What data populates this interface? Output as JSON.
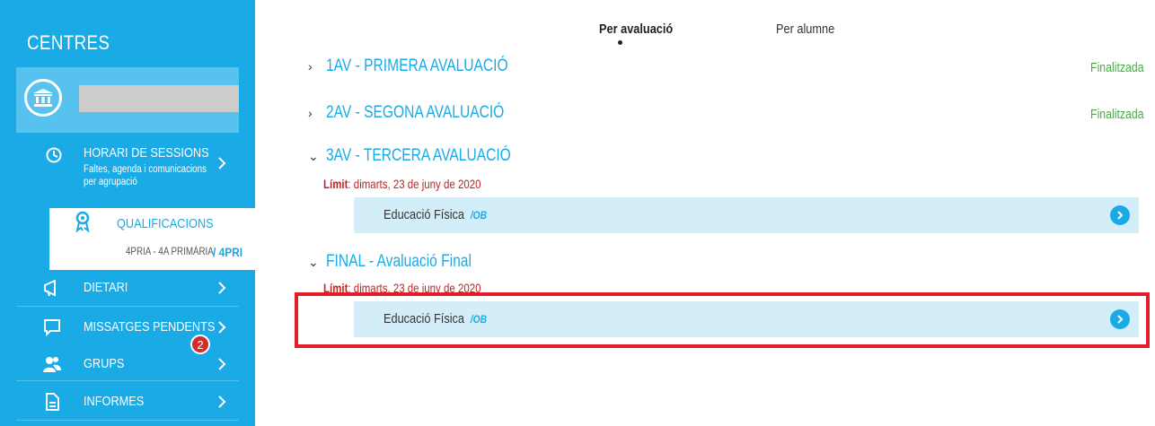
{
  "sidebar": {
    "title": "CENTRES",
    "sessions": {
      "title": "HORARI DE SESSIONS",
      "subtitle": "Faltes, agenda i comunicacions per agrupació"
    },
    "qualifications": {
      "label": "QUALIFICACIONS",
      "group": "4PRIA - 4A PRIMÀRIA",
      "code": "/ 4PRI"
    },
    "items": [
      {
        "label": "DIETARI",
        "icon": "megaphone-icon"
      },
      {
        "label": "MISSATGES PENDENTS",
        "icon": "chat-icon",
        "badge": "2"
      },
      {
        "label": "GRUPS",
        "icon": "users-icon"
      },
      {
        "label": "INFORMES",
        "icon": "document-icon"
      }
    ]
  },
  "tabs": {
    "active": "Per avaluació",
    "other": "Per alumne"
  },
  "evaluations": [
    {
      "title": "1AV - PRIMERA AVALUACIÓ",
      "status": "Finalitzada",
      "expanded": false
    },
    {
      "title": "2AV - SEGONA AVALUACIÓ",
      "status": "Finalitzada",
      "expanded": false
    },
    {
      "title": "3AV - TERCERA AVALUACIÓ",
      "expanded": true,
      "limit_label": "Límit",
      "limit_date": ": dimarts, 23 de juny de 2020",
      "subject": "Educació Física",
      "subject_code": "/OB"
    },
    {
      "title": "FINAL - Avaluació Final",
      "expanded": true,
      "limit_label": "Límit",
      "limit_date": ": dimarts, 23 de juny de 2020",
      "subject": "Educació Física",
      "subject_code": "/OB"
    }
  ],
  "colors": {
    "primary": "#1aaae5",
    "status_done": "#3bb33b",
    "limit_red": "#c92020",
    "highlight": "#e11d2a"
  }
}
